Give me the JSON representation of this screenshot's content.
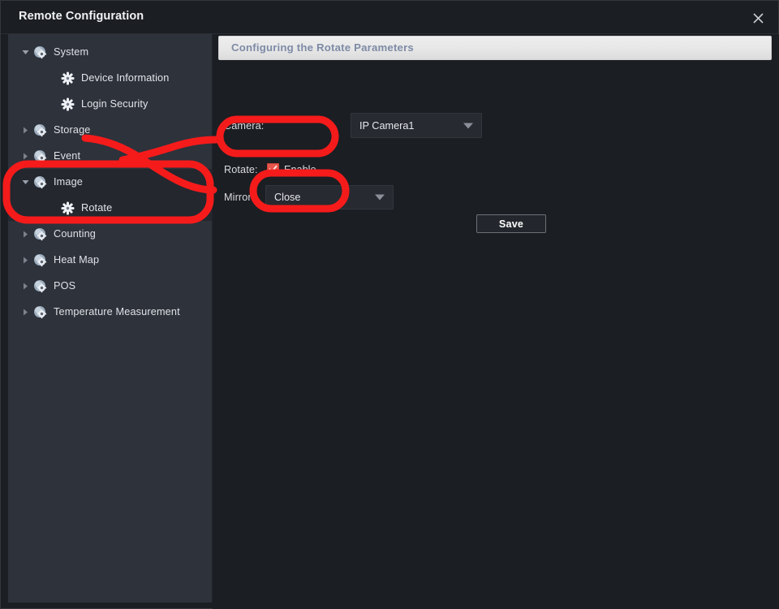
{
  "window": {
    "title": "Remote Configuration",
    "close_icon": "close-icon"
  },
  "sidebar": {
    "items": [
      {
        "label": "System",
        "level": 0,
        "twisty": "expanded",
        "icon": "gear-sphere-icon",
        "selected": false
      },
      {
        "label": "Device Information",
        "level": 1,
        "twisty": "none",
        "icon": "gear-icon",
        "selected": false
      },
      {
        "label": "Login Security",
        "level": 1,
        "twisty": "none",
        "icon": "gear-icon",
        "selected": false
      },
      {
        "label": "Storage",
        "level": 0,
        "twisty": "collapsed",
        "icon": "gear-sphere-icon",
        "selected": false
      },
      {
        "label": "Event",
        "level": 0,
        "twisty": "collapsed",
        "icon": "gear-sphere-icon",
        "selected": false
      },
      {
        "label": "Image",
        "level": 0,
        "twisty": "expanded",
        "icon": "gear-sphere-icon",
        "selected": true
      },
      {
        "label": "Rotate",
        "level": 1,
        "twisty": "none",
        "icon": "gear-icon",
        "selected": true
      },
      {
        "label": "Counting",
        "level": 0,
        "twisty": "collapsed",
        "icon": "gear-sphere-icon",
        "selected": false
      },
      {
        "label": "Heat Map",
        "level": 0,
        "twisty": "collapsed",
        "icon": "gear-sphere-icon",
        "selected": false
      },
      {
        "label": "POS",
        "level": 0,
        "twisty": "collapsed",
        "icon": "gear-sphere-icon",
        "selected": false
      },
      {
        "label": "Temperature Measurement",
        "level": 0,
        "twisty": "collapsed",
        "icon": "gear-sphere-icon",
        "selected": false
      }
    ]
  },
  "main": {
    "banner_title": "Configuring the Rotate Parameters",
    "camera": {
      "label": "Camera:",
      "value": "IP Camera1",
      "options": [
        "IP Camera1"
      ],
      "arrow_icon": "chevron-down-icon"
    },
    "rotate": {
      "label": "Rotate:",
      "checkbox_label": "Enable",
      "checked": true,
      "check_icon": "check-icon"
    },
    "mirror": {
      "label": "Mirror:",
      "value": "Close",
      "options": [
        "Close"
      ],
      "arrow_icon": "chevron-down-icon"
    },
    "save_label": "Save"
  },
  "annotation": {
    "color": "#f51b1b",
    "stroke_width": 9,
    "shapes": [
      "sidebar-image-rotate-highlight",
      "rotate-enable-highlight",
      "save-button-highlight",
      "connector-arc"
    ]
  },
  "colors": {
    "accent_red": "#f51b1b",
    "checkbox_red": "#e8554a",
    "banner_bg": "#e8e8e8",
    "banner_text": "#7e8ba6",
    "sidebar_bg": "#2e323b",
    "main_bg": "#1b1e23"
  }
}
